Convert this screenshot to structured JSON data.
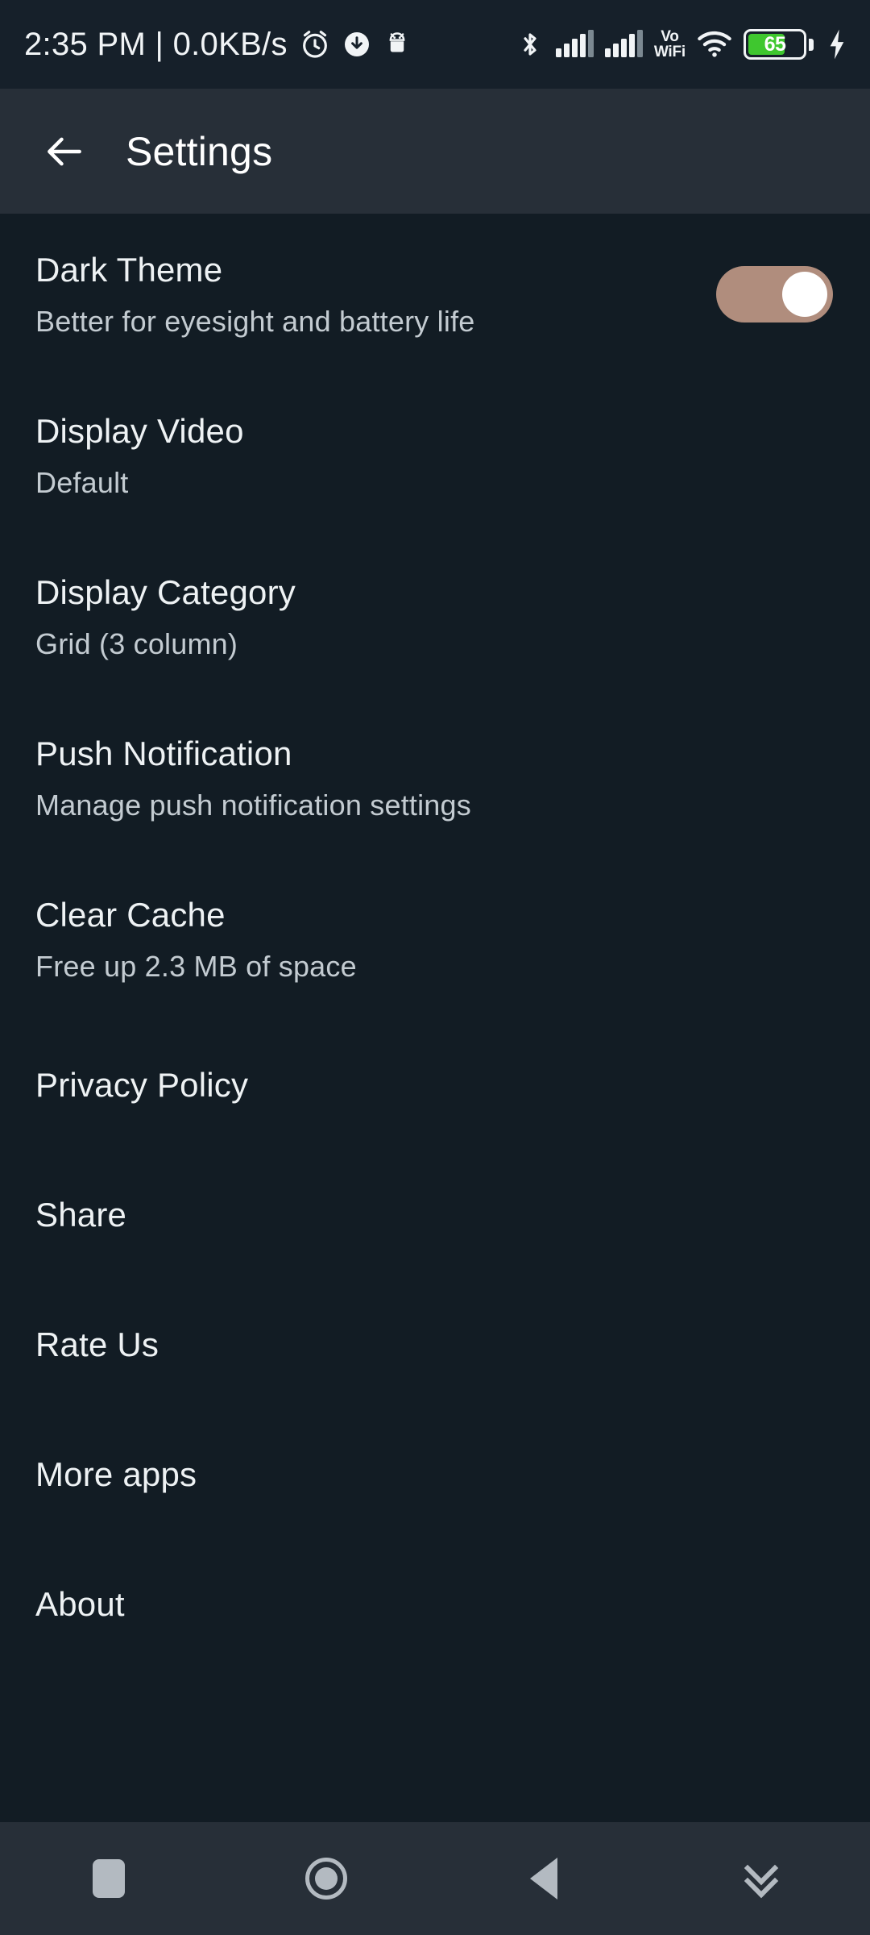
{
  "statusbar": {
    "clock_text": "2:35 PM | 0.0KB/s",
    "alarm_icon": "alarm-clock-icon",
    "download_icon": "download-circle-icon",
    "android_icon": "android-robot-icon",
    "bluetooth_icon": "bluetooth-icon",
    "signal_icon": "cellular-signal-icon",
    "volte_line1": "Vo",
    "volte_line2": "WiFi",
    "wifi_icon": "wifi-icon",
    "battery_level": "65",
    "battery_color": "#3fc72f",
    "charging_icon": "charging-bolt-icon"
  },
  "appbar": {
    "back_icon": "arrow-left-icon",
    "title": "Settings",
    "background": "#272f38"
  },
  "theme": {
    "page_background": "#121c24",
    "switch_track": "#b08d7d",
    "switch_thumb": "#ffffff",
    "title_color": "#eef2f4",
    "subtitle_color": "#c3cbd1"
  },
  "settings": {
    "items": [
      {
        "title": "Dark Theme",
        "subtitle": "Better for eyesight and battery life",
        "control": "switch",
        "switch_on": true
      },
      {
        "title": "Display Video",
        "subtitle": "Default",
        "control": "none"
      },
      {
        "title": "Display Category",
        "subtitle": "Grid (3 column)",
        "control": "none"
      },
      {
        "title": "Push Notification",
        "subtitle": "Manage push notification settings",
        "control": "none"
      },
      {
        "title": "Clear Cache",
        "subtitle": "Free up 2.3 MB of space",
        "control": "none"
      },
      {
        "title": "Privacy Policy",
        "subtitle": "",
        "control": "none"
      },
      {
        "title": "Share",
        "subtitle": "",
        "control": "none"
      },
      {
        "title": "Rate Us",
        "subtitle": "",
        "control": "none"
      },
      {
        "title": "More apps",
        "subtitle": "",
        "control": "none"
      },
      {
        "title": "About",
        "subtitle": "",
        "control": "none"
      }
    ]
  },
  "navbar": {
    "background": "#272f38",
    "icon_color": "#b3bac1",
    "buttons": [
      {
        "name": "recents-button",
        "icon": "square-icon"
      },
      {
        "name": "home-button",
        "icon": "circle-icon"
      },
      {
        "name": "back-button",
        "icon": "triangle-left-icon"
      },
      {
        "name": "hide-keyboard-button",
        "icon": "chevron-double-down-icon"
      }
    ]
  }
}
